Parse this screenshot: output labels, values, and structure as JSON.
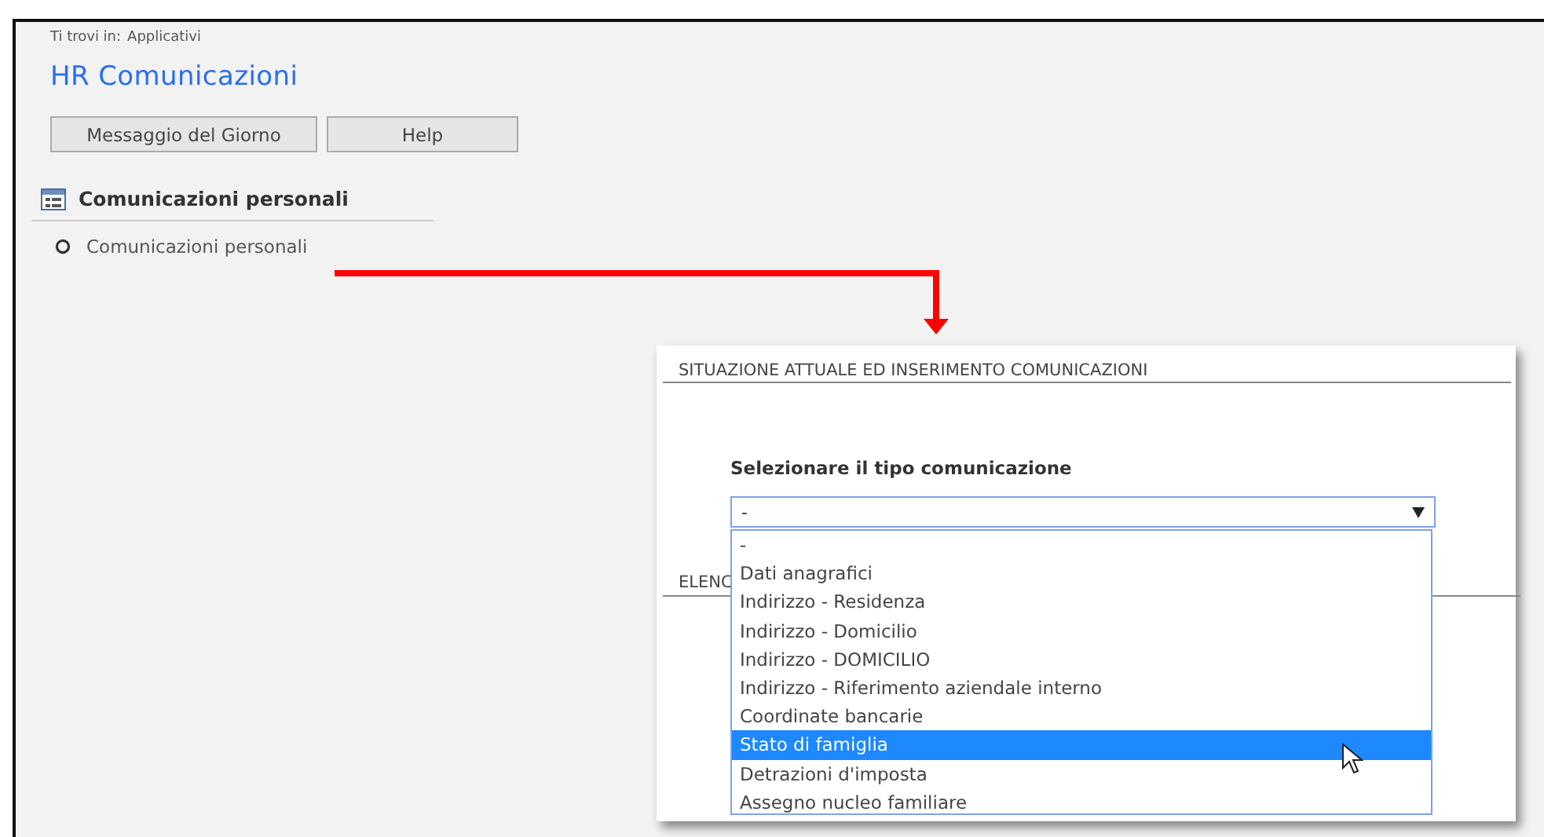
{
  "breadcrumb": {
    "label": "Ti trovi in:",
    "value": "Applicativi"
  },
  "title": "HR Comunicazioni",
  "buttons": [
    "Messaggio del Giorno",
    "Help"
  ],
  "section": {
    "title": "Comunicazioni personali",
    "items": [
      {
        "label": "Comunicazioni personali"
      }
    ]
  },
  "panel": {
    "title": "SITUAZIONE ATTUALE ED INSERIMENTO COMUNICAZIONI",
    "field": {
      "label": "Selezionare il tipo comunicazione",
      "value": "-",
      "expanded": true,
      "options": [
        {
          "label": "-",
          "highlighted": false
        },
        {
          "label": "Dati anagrafici",
          "highlighted": false
        },
        {
          "label": "Indirizzo - Residenza",
          "highlighted": false
        },
        {
          "label": "Indirizzo - Domicilio",
          "highlighted": false
        },
        {
          "label": "Indirizzo - DOMICILIO",
          "highlighted": false
        },
        {
          "label": "Indirizzo - Riferimento aziendale interno",
          "highlighted": false
        },
        {
          "label": "Coordinate bancarie",
          "highlighted": false
        },
        {
          "label": "Stato di famiglia",
          "highlighted": true
        },
        {
          "label": "Detrazioni d'imposta",
          "highlighted": false
        },
        {
          "label": "Assegno nucleo familiare",
          "highlighted": false
        }
      ]
    },
    "section_2_title": "ELENC"
  }
}
